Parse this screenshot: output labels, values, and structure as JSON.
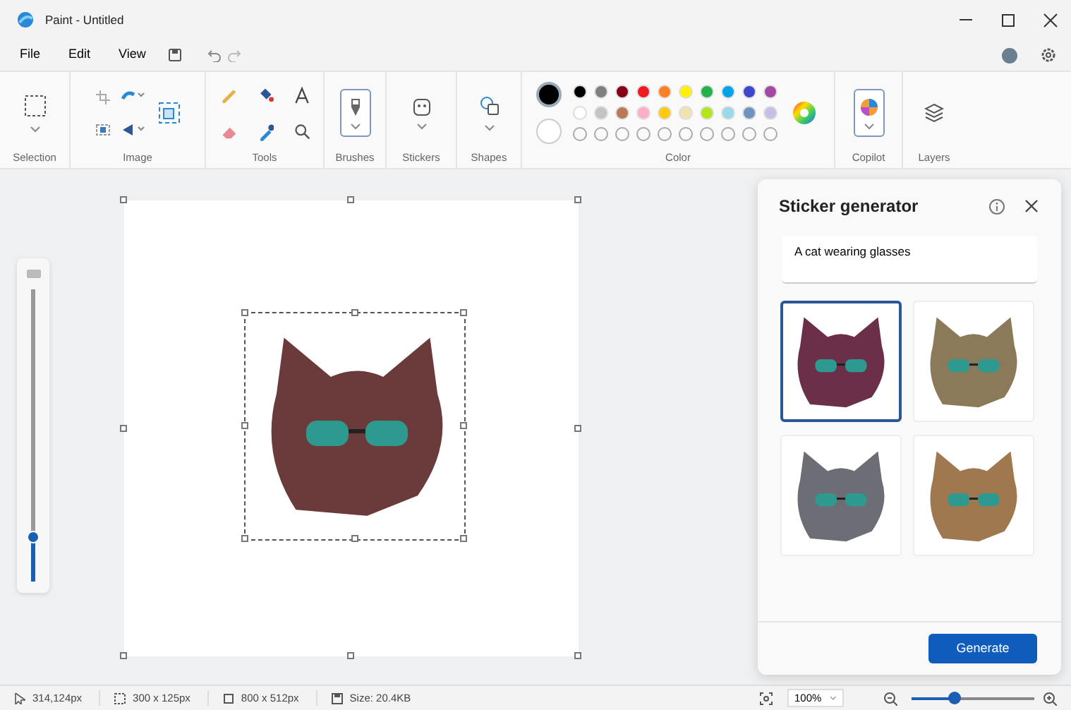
{
  "window": {
    "title": "Paint - Untitled"
  },
  "menu": [
    {
      "label": "File"
    },
    {
      "label": "Edit"
    },
    {
      "label": "View"
    }
  ],
  "ribbon": {
    "groups": [
      {
        "kind": "selection",
        "label": "Selection"
      },
      {
        "kind": "image",
        "label": "Image"
      },
      {
        "kind": "tools",
        "label": "Tools"
      },
      {
        "kind": "brushes",
        "label": "Brushes",
        "selected": true
      },
      {
        "kind": "stickers",
        "label": "Stickers",
        "selected": false
      },
      {
        "kind": "shapes",
        "label": "Shapes"
      },
      {
        "kind": "color",
        "label": "Color"
      },
      {
        "kind": "copilot",
        "label": "Copilot",
        "selected": true
      },
      {
        "kind": "layers",
        "label": "Layers"
      }
    ]
  },
  "colors": {
    "current": [
      {
        "color": "#000000",
        "selected": true
      },
      {
        "color": "#ffffff",
        "selected": false
      }
    ],
    "palette": [
      {
        "color": "#000000"
      },
      {
        "color": "#7f7f7f"
      },
      {
        "color": "#880015"
      },
      {
        "color": "#ed1c24"
      },
      {
        "color": "#ff7f27"
      },
      {
        "color": "#fff200"
      },
      {
        "color": "#22b14c"
      },
      {
        "color": "#00a2e8"
      },
      {
        "color": "#3f48cc"
      },
      {
        "color": "#a349a4"
      },
      {
        "color": "#ffffff"
      },
      {
        "color": "#c3c3c3"
      },
      {
        "color": "#b97a57"
      },
      {
        "color": "#ffaec9"
      },
      {
        "color": "#ffc90e"
      },
      {
        "color": "#efe4b0"
      },
      {
        "color": "#b5e61d"
      },
      {
        "color": "#99d9ea"
      },
      {
        "color": "#7092be"
      },
      {
        "color": "#c8bfe7"
      }
    ]
  },
  "brush_size": {
    "level": 0.15
  },
  "sticker_panel": {
    "title": "Sticker generator",
    "prompt": "A cat wearing glasses",
    "stickers": [
      {
        "selected": true,
        "color": "#6b2f4a"
      },
      {
        "selected": false,
        "color": "#8a7a5a"
      },
      {
        "selected": false,
        "color": "#6d6d75"
      },
      {
        "selected": false,
        "color": "#a07850"
      }
    ],
    "button": "Generate"
  },
  "status_bar": {
    "cursor": "314,124px",
    "selection": "300 x 125px",
    "canvas": "800 x 512px",
    "size": "Size: 20.4KB",
    "zoom": "100%",
    "zoom_slider": {
      "level": 0.35
    }
  }
}
